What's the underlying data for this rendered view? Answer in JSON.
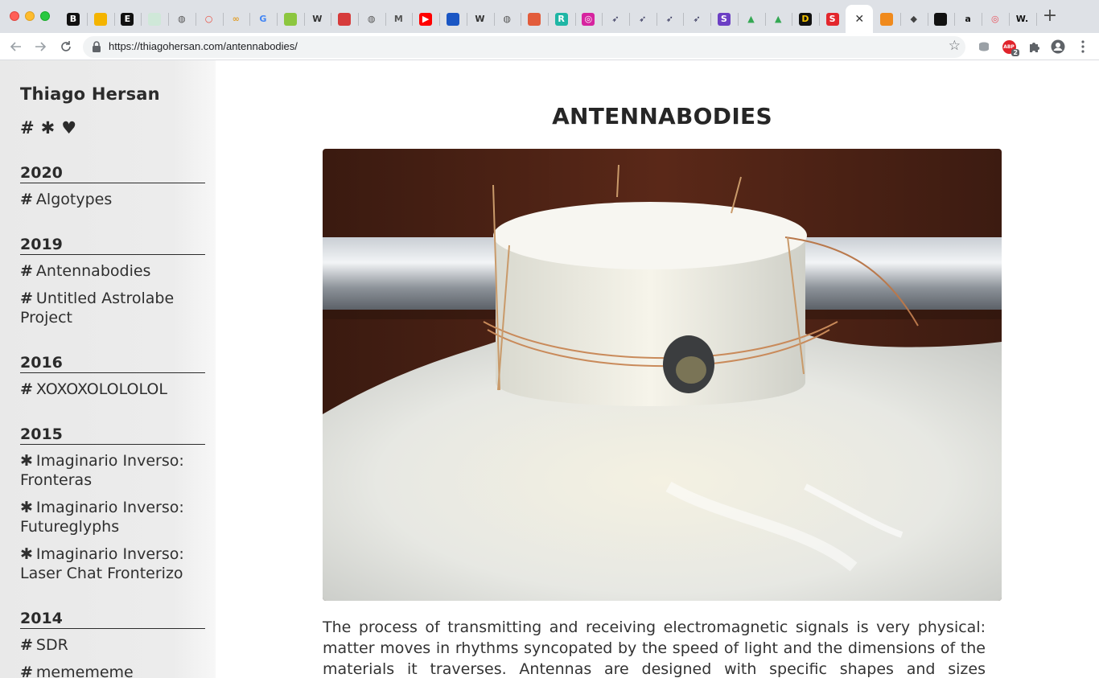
{
  "browser": {
    "url": "https://thiagohersan.com/antennabodies/",
    "tabs": [
      {
        "icon": "b-icon",
        "glyph": "B",
        "bg": "#111111",
        "fg": "#ffffff"
      },
      {
        "icon": "slides-icon",
        "glyph": "",
        "bg": "#f4b400",
        "fg": "#ffffff"
      },
      {
        "icon": "e-icon",
        "glyph": "E",
        "bg": "#111111",
        "fg": "#ffffff"
      },
      {
        "icon": "sheet-icon",
        "glyph": "",
        "bg": "#cfe8d8",
        "fg": "#ffffff"
      },
      {
        "icon": "globe-icon",
        "glyph": "◍",
        "bg": "transparent",
        "fg": "#555555"
      },
      {
        "icon": "ring-icon",
        "glyph": "○",
        "bg": "transparent",
        "fg": "#e94b3c"
      },
      {
        "icon": "infinity-icon",
        "glyph": "∞",
        "bg": "transparent",
        "fg": "#e0a030"
      },
      {
        "icon": "google-icon",
        "glyph": "G",
        "bg": "transparent",
        "fg": "#4285f4"
      },
      {
        "icon": "leaf-icon",
        "glyph": "",
        "bg": "#8cc63f",
        "fg": "#ffffff"
      },
      {
        "icon": "wikipedia-icon",
        "glyph": "W",
        "bg": "transparent",
        "fg": "#333333"
      },
      {
        "icon": "pocket-icon",
        "glyph": "",
        "bg": "#d63b3b",
        "fg": "#ffffff"
      },
      {
        "icon": "globe-icon",
        "glyph": "◍",
        "bg": "transparent",
        "fg": "#555555"
      },
      {
        "icon": "medium-icon",
        "glyph": "M",
        "bg": "transparent",
        "fg": "#555555"
      },
      {
        "icon": "youtube-icon",
        "glyph": "▶",
        "bg": "#ff0000",
        "fg": "#ffffff"
      },
      {
        "icon": "circle-icon",
        "glyph": "",
        "bg": "#1a56c4",
        "fg": "#ffffff"
      },
      {
        "icon": "wikipedia-icon",
        "glyph": "W",
        "bg": "transparent",
        "fg": "#333333"
      },
      {
        "icon": "globe-icon",
        "glyph": "◍",
        "bg": "transparent",
        "fg": "#555555"
      },
      {
        "icon": "map-icon",
        "glyph": "",
        "bg": "#e25c3b",
        "fg": "#ffffff"
      },
      {
        "icon": "r-icon",
        "glyph": "R",
        "bg": "#1fb6a5",
        "fg": "#ffffff"
      },
      {
        "icon": "instagram-icon",
        "glyph": "◎",
        "bg": "#d6249f",
        "fg": "#ffffff"
      },
      {
        "icon": "arrow-icon",
        "glyph": "➶",
        "bg": "transparent",
        "fg": "#2c2c54"
      },
      {
        "icon": "arrow-icon",
        "glyph": "➶",
        "bg": "transparent",
        "fg": "#2c2c54"
      },
      {
        "icon": "arrow-icon",
        "glyph": "➶",
        "bg": "transparent",
        "fg": "#2c2c54"
      },
      {
        "icon": "arrow-icon",
        "glyph": "➶",
        "bg": "transparent",
        "fg": "#2c2c54"
      },
      {
        "icon": "s-icon",
        "glyph": "S",
        "bg": "#6c3fc4",
        "fg": "#ffffff"
      },
      {
        "icon": "drive-icon",
        "glyph": "▲",
        "bg": "transparent",
        "fg": "#34a853"
      },
      {
        "icon": "drive-icon",
        "glyph": "▲",
        "bg": "transparent",
        "fg": "#34a853"
      },
      {
        "icon": "d-icon",
        "glyph": "D",
        "bg": "#111111",
        "fg": "#f2c200"
      },
      {
        "icon": "s-icon",
        "glyph": "S",
        "bg": "#e3262c",
        "fg": "#ffffff"
      },
      {
        "icon": "close-icon",
        "glyph": "✕",
        "bg": "transparent",
        "fg": "#333333",
        "active": true
      },
      {
        "icon": "grid-icon",
        "glyph": "",
        "bg": "#f08a1c",
        "fg": "#ffffff"
      },
      {
        "icon": "diamond-icon",
        "glyph": "◆",
        "bg": "transparent",
        "fg": "#444444"
      },
      {
        "icon": "black-circle-icon",
        "glyph": "",
        "bg": "#111111",
        "fg": "#ffffff"
      },
      {
        "icon": "amazon-icon",
        "glyph": "a",
        "bg": "transparent",
        "fg": "#111111"
      },
      {
        "icon": "target-icon",
        "glyph": "◎",
        "bg": "transparent",
        "fg": "#e8505b"
      },
      {
        "icon": "w-icon",
        "glyph": "W.",
        "bg": "transparent",
        "fg": "#111111"
      }
    ],
    "extension_badge": "2"
  },
  "sidebar": {
    "site_title": "Thiago Hersan",
    "legend_symbols": [
      "#",
      "✱",
      "♥"
    ],
    "groups": [
      {
        "year": "2020",
        "projects": [
          {
            "sym": "#",
            "title": "Algotypes"
          }
        ]
      },
      {
        "year": "2019",
        "projects": [
          {
            "sym": "#",
            "title": "Antennabodies"
          },
          {
            "sym": "#",
            "title": "Untitled Astrolabe Project"
          }
        ]
      },
      {
        "year": "2016",
        "projects": [
          {
            "sym": "#",
            "title": "XOXOXOLOLOLOL"
          }
        ]
      },
      {
        "year": "2015",
        "projects": [
          {
            "sym": "✱",
            "title": "Imaginario Inverso: Fronteras"
          },
          {
            "sym": "✱",
            "title": "Imaginario Inverso: Futureglyphs"
          },
          {
            "sym": "✱",
            "title": "Imaginario Inverso: Laser Chat Fronterizo"
          }
        ]
      },
      {
        "year": "2014",
        "projects": [
          {
            "sym": "#",
            "title": "SDR"
          },
          {
            "sym": "#",
            "title": "memememe"
          }
        ]
      }
    ]
  },
  "main": {
    "title": "ANTENNABODIES",
    "body": "The process of transmitting and receiving electromagnetic signals is very physical: matter moves in rhythms syncopated by the speed of light and the dimensions of the materials it traverses. Antennas are designed with specific shapes and sizes optimized"
  }
}
